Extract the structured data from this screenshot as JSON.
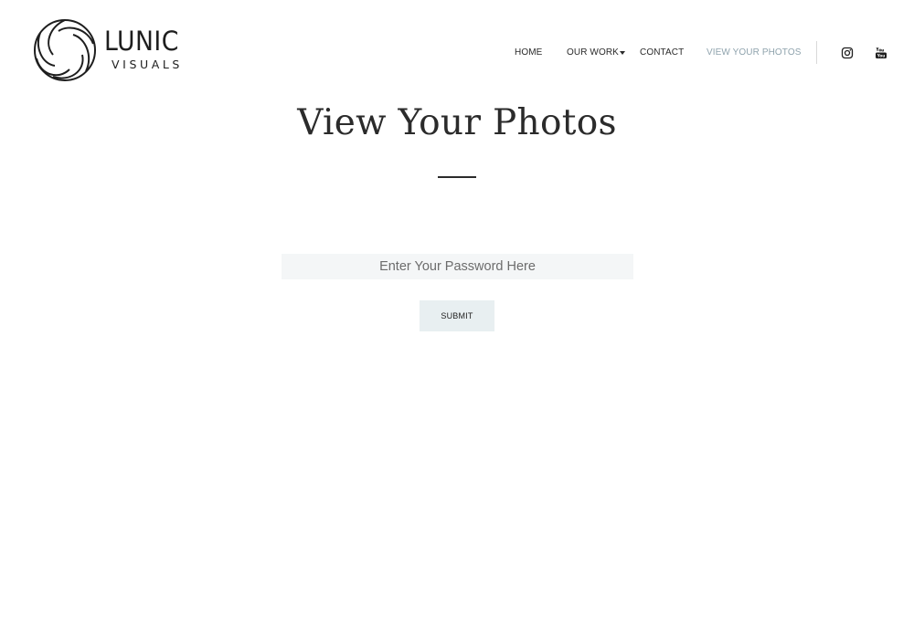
{
  "brand": {
    "name": "LUNIC",
    "tagline": "VISUALS",
    "logo_icon": "swirl-logo-icon"
  },
  "nav": {
    "items": [
      {
        "label": "HOME"
      },
      {
        "label": "OUR WORK",
        "has_dropdown": true
      },
      {
        "label": "CONTACT"
      },
      {
        "label": "VIEW YOUR PHOTOS",
        "active": true
      }
    ]
  },
  "social": {
    "instagram_icon": "instagram-icon",
    "youtube_icon": "youtube-icon"
  },
  "main": {
    "title": "View Your Photos",
    "password_placeholder": "Enter Your Password Here",
    "submit_label": "SUBMIT"
  },
  "colors": {
    "active_nav": "#8fa3ad",
    "input_bg": "#f4f6f7",
    "button_bg": "#e8eff1",
    "text": "#2b2b2b"
  }
}
